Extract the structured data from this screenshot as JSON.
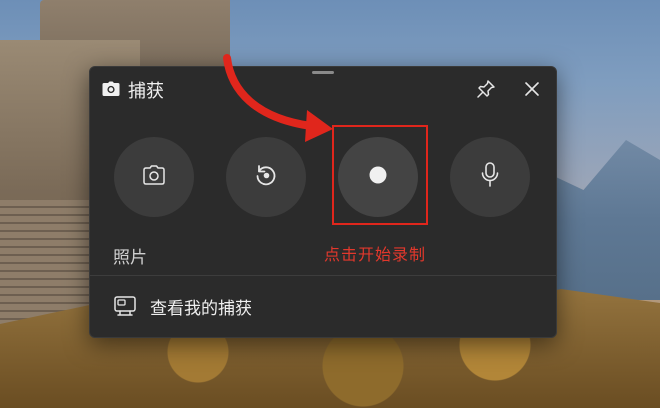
{
  "panel": {
    "title": "捕获",
    "title_icon": "camera-icon",
    "pin_icon": "pin-icon",
    "close_icon": "close-icon"
  },
  "buttons": [
    {
      "name": "photo",
      "icon": "camera-icon"
    },
    {
      "name": "replay",
      "icon": "replay-icon"
    },
    {
      "name": "record",
      "icon": "record-dot-icon"
    },
    {
      "name": "microphone",
      "icon": "microphone-icon"
    }
  ],
  "labels": {
    "photo": "照片"
  },
  "annotation": {
    "text": "点击开始录制",
    "color": "#e2382c"
  },
  "gallery": {
    "label": "查看我的捕获",
    "icon": "gallery-icon"
  },
  "colors": {
    "panel_bg": "#2b2b2b",
    "button_bg": "#3c3c3c",
    "highlight": "#e0261c",
    "text": "#efefef"
  }
}
